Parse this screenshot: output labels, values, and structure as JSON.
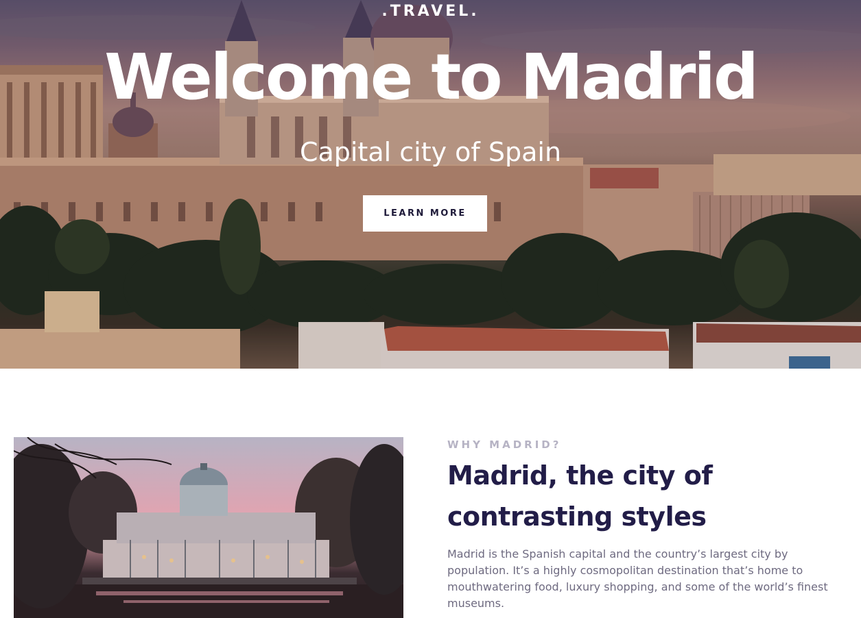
{
  "hero": {
    "brand": ".TRAVEL.",
    "title": "Welcome to Madrid",
    "subtitle": "Capital city of Spain",
    "cta_label": "LEARN MORE",
    "image": "madrid-royal-palace-cathedral-cityscape"
  },
  "about": {
    "eyebrow": "WHY MADRID?",
    "title_line1": "Madrid, the city of",
    "title_line2": "contrasting styles",
    "body": "Madrid is the Spanish capital and the country’s largest city by population. It’s a highly cosmopolitan destination that’s home to mouthwatering food, luxury shopping, and some of the world’s finest museums.",
    "image": "crystal-palace-retiro-park-sunset"
  },
  "colors": {
    "heading": "#221d48",
    "eyebrow": "#b6b3c4",
    "body": "#6e6a80",
    "button_bg": "#ffffff",
    "button_text": "#1f1b3a"
  }
}
